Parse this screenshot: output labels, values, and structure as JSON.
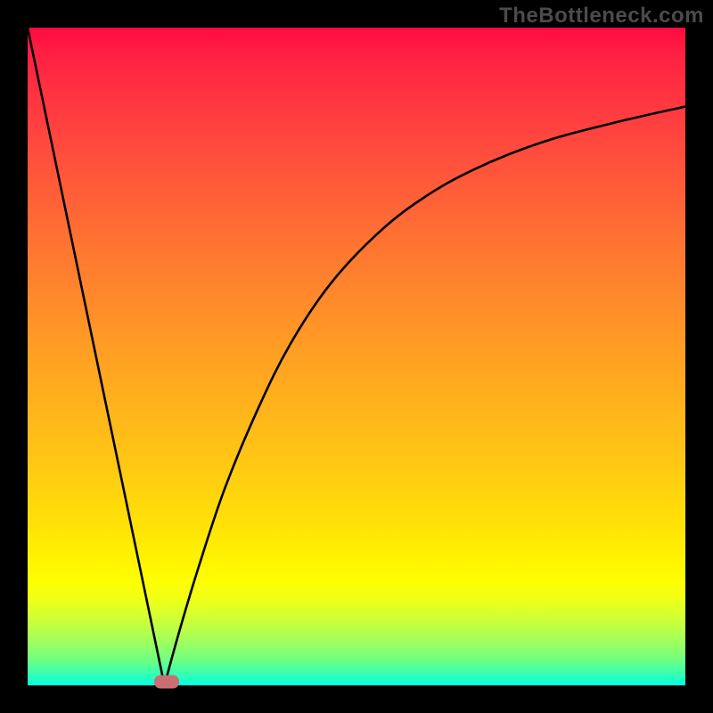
{
  "watermark": "TheBottleneck.com",
  "chart_data": {
    "type": "line",
    "title": "",
    "xlabel": "",
    "ylabel": "",
    "xlim": [
      0,
      100
    ],
    "ylim": [
      0,
      100
    ],
    "grid": false,
    "legend": false,
    "series": [
      {
        "name": "left-branch",
        "x": [
          0,
          20.8
        ],
        "y": [
          100,
          0
        ]
      },
      {
        "name": "right-branch",
        "x": [
          20.8,
          23,
          26,
          30,
          35,
          40,
          46,
          53,
          60,
          68,
          78,
          89,
          100
        ],
        "y": [
          0,
          8,
          18,
          30,
          42,
          52,
          61,
          68.5,
          74,
          78.5,
          82.5,
          85.5,
          88
        ]
      }
    ],
    "marker": {
      "x": 21.2,
      "y": 0.5
    },
    "colors": {
      "curve": "#000000",
      "marker": "#ca6e72"
    }
  }
}
